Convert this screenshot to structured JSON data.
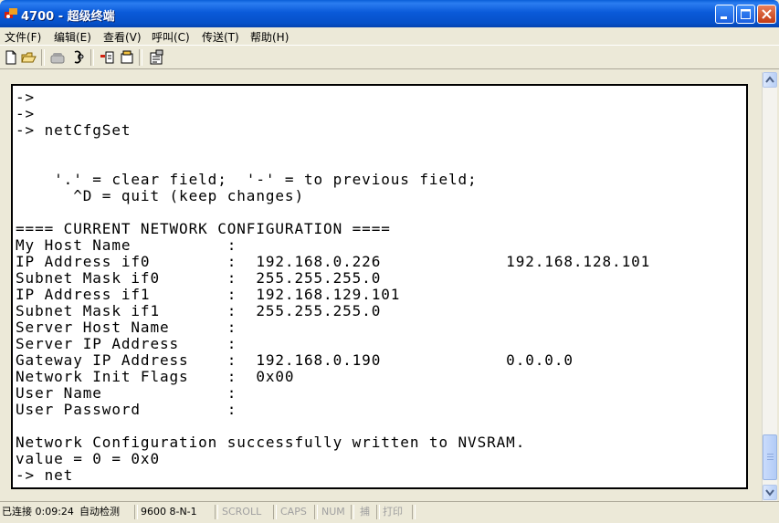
{
  "window": {
    "title": "4700 - 超级终端",
    "buttons": {
      "minimize": "minimize",
      "maximize": "maximize",
      "close": "close"
    }
  },
  "menu": [
    {
      "label": "文件(F)"
    },
    {
      "label": "编辑(E)"
    },
    {
      "label": "查看(V)"
    },
    {
      "label": "呼叫(C)"
    },
    {
      "label": "传送(T)"
    },
    {
      "label": "帮助(H)"
    }
  ],
  "toolbar": {
    "icons": [
      "new-document-icon",
      "open-folder-icon",
      "phone-call-icon",
      "disconnect-icon",
      "send-file-icon",
      "receive-file-icon",
      "properties-icon"
    ]
  },
  "terminal": {
    "lines": [
      "->",
      "->",
      "-> netCfgSet",
      "",
      "",
      "    '.' = clear field;  '-' = to previous field;",
      "      ^D = quit (keep changes)",
      "",
      "==== CURRENT NETWORK CONFIGURATION ====",
      "My Host Name          :",
      "IP Address if0        :  192.168.0.226             192.168.128.101",
      "Subnet Mask if0       :  255.255.255.0",
      "IP Address if1        :  192.168.129.101",
      "Subnet Mask if1       :  255.255.255.0",
      "Server Host Name      :",
      "Server IP Address     :",
      "Gateway IP Address    :  192.168.0.190             0.0.0.0",
      "Network Init Flags    :  0x00",
      "User Name             :",
      "User Password         :",
      "",
      "Network Configuration successfully written to NVSRAM.",
      "value = 0 = 0x0",
      "-> net"
    ]
  },
  "status": {
    "connection": "已连接 0:09:24",
    "detect": "自动检测",
    "settings": "9600 8-N-1",
    "scroll": "SCROLL",
    "caps": "CAPS",
    "num": "NUM",
    "capture": "捕",
    "print": "打印"
  },
  "colors": {
    "titlebar": "#0a5ad9",
    "chrome": "#ece9d8",
    "terminal_bg": "#ffffff",
    "terminal_fg": "#000000"
  }
}
